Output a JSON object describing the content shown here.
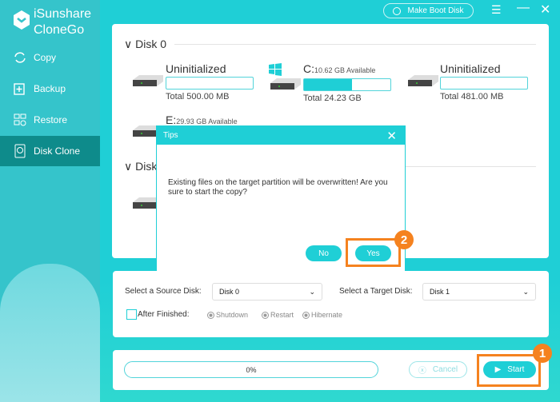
{
  "app": {
    "name_line1": "iSunshare",
    "name_line2": "CloneGo"
  },
  "sidebar": {
    "items": [
      {
        "label": "Copy",
        "icon": "sync-icon"
      },
      {
        "label": "Backup",
        "icon": "backup-icon"
      },
      {
        "label": "Restore",
        "icon": "restore-icon"
      },
      {
        "label": "Disk Clone",
        "icon": "disk-clone-icon",
        "selected": true
      }
    ]
  },
  "header": {
    "boot_label": "Make Boot Disk"
  },
  "disks": [
    {
      "name": "Disk 0",
      "partitions": [
        {
          "label": "Uninitialized",
          "available": "",
          "total": "Total 500.00 MB",
          "used_percent": 0
        },
        {
          "label": "C:",
          "available": "10.62 GB Available",
          "total": "Total 24.23 GB",
          "used_percent": 56,
          "os": true
        },
        {
          "label": "Uninitialized",
          "available": "",
          "total": "Total 481.00 MB",
          "used_percent": 0
        },
        {
          "label": "E:",
          "available": "29.93 GB Available"
        }
      ]
    },
    {
      "name": "Disk 1"
    }
  ],
  "dialog": {
    "title": "Tips",
    "message": "Existing files on the target partition will be overwritten! Are you sure to start the copy?",
    "no": "No",
    "yes": "Yes",
    "badge": "2"
  },
  "options": {
    "source_label": "Select a Source Disk:",
    "source_value": "Disk 0",
    "target_label": "Select a Target Disk:",
    "target_value": "Disk 1",
    "after_label": "After Finished:",
    "after_checked": false,
    "radios": [
      "Shutdown",
      "Restart",
      "Hibernate"
    ]
  },
  "progress": {
    "text": "0%",
    "value": 0
  },
  "actions": {
    "cancel": "Cancel",
    "start": "Start",
    "badge": "1"
  },
  "colors": {
    "accent": "#1fcfd6",
    "sidebar_selected": "#0e8b8b",
    "highlight": "#f5821f"
  }
}
